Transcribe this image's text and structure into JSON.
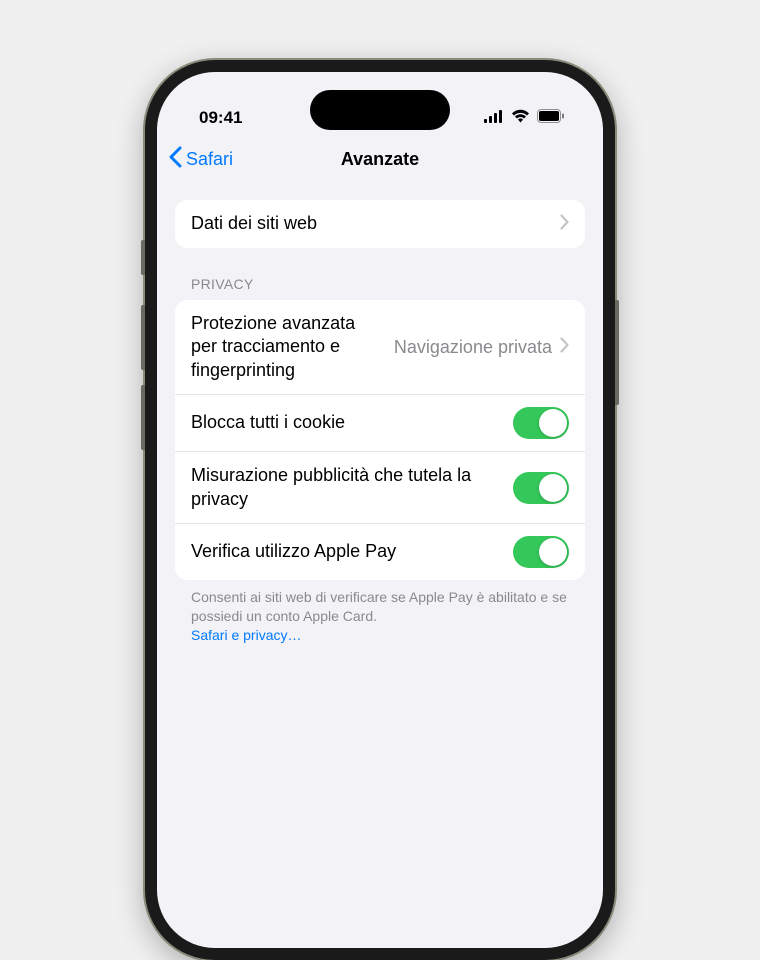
{
  "status_bar": {
    "time": "09:41"
  },
  "nav": {
    "back_label": "Safari",
    "title": "Avanzate"
  },
  "group1": {
    "row_website_data": "Dati dei siti web"
  },
  "privacy": {
    "header": "Privacy",
    "tracking": {
      "label": "Protezione avanzata per tracciamento e fingerprinting",
      "value": "Navigazione privata"
    },
    "block_cookies": "Blocca tutti i cookie",
    "ad_measurement": "Misurazione pubblicità che tutela la privacy",
    "apple_pay_check": "Verifica utilizzo Apple Pay",
    "footer": "Consenti ai siti web di verificare se Apple Pay è abilitato e se possiedi un conto Apple Card.",
    "footer_link": "Safari e privacy…"
  },
  "toggles": {
    "block_cookies": true,
    "ad_measurement": true,
    "apple_pay_check": true
  }
}
